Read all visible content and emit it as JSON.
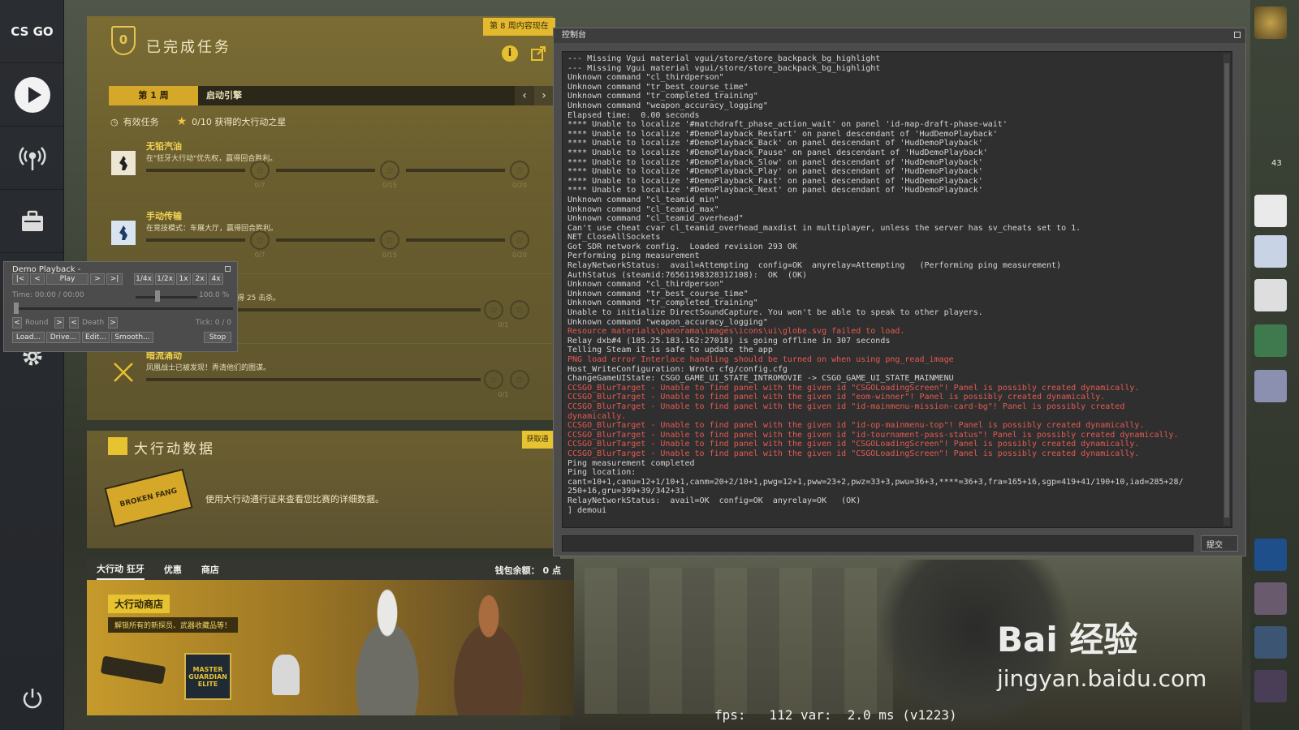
{
  "app": {
    "logo": "CS GO"
  },
  "sidebar": {
    "items": [
      {
        "icon": "play-icon"
      },
      {
        "icon": "antenna-icon"
      },
      {
        "icon": "briefcase-icon"
      },
      {
        "icon": "gear-icon"
      },
      {
        "icon": "power-icon"
      }
    ]
  },
  "missions": {
    "badge": "0",
    "title": "已完成任务",
    "week_tag": "第 8 周内容现在",
    "week_label": "第 1 周",
    "week_name": "启动引擎",
    "status_active": "有效任务",
    "status_stars": "0/10 获得的大行动之星",
    "items": [
      {
        "name": "无铅汽油",
        "desc": "在\"狂牙大行动\"优先权，赢得回合胜利。",
        "counts": [
          "0/7",
          "0/15",
          "0/20"
        ]
      },
      {
        "name": "手动传输",
        "desc": "在竞技模式：车展大厅，赢得回合胜利。",
        "counts": [
          "0/7",
          "0/15",
          "0/20"
        ]
      },
      {
        "name": "",
        "desc": "得 25 击杀。",
        "counts": [
          "",
          "0/1"
        ]
      },
      {
        "name": "暗流涌动",
        "desc": "凤凰战士已被发现！弄清他们的图谋。",
        "counts": [
          "",
          "0/1"
        ]
      }
    ]
  },
  "opdata": {
    "title": "大行动数据",
    "button": "获取通",
    "ticket": "BROKEN FANG",
    "desc": "使用大行动通行证来查看您比赛的详细数据。"
  },
  "store": {
    "tabs": [
      "大行动 狂牙",
      "优惠",
      "商店"
    ],
    "wallet": "钱包余额： 0 点",
    "banner_title": "大行动商店",
    "banner_sub": "解锁所有的新探员、武器收藏品等！",
    "patch_text": "MASTER GUARDIAN ELITE"
  },
  "console": {
    "title": "控制台",
    "submit": "提交",
    "input_value": "",
    "lines": [
      {
        "t": "--- Missing Vgui material vgui/store/store_backpack_bg_highlight",
        "e": false
      },
      {
        "t": "--- Missing Vgui material vgui/store/store_backpack_bg_highlight",
        "e": false
      },
      {
        "t": "Unknown command \"cl_thirdperson\"",
        "e": false
      },
      {
        "t": "Unknown command \"tr_best_course_time\"",
        "e": false
      },
      {
        "t": "Unknown command \"tr_completed_training\"",
        "e": false
      },
      {
        "t": "Unknown command \"weapon_accuracy_logging\"",
        "e": false
      },
      {
        "t": "Elapsed time:  0.00 seconds",
        "e": false
      },
      {
        "t": "**** Unable to localize '#matchdraft_phase_action_wait' on panel 'id-map-draft-phase-wait'",
        "e": false
      },
      {
        "t": "**** Unable to localize '#DemoPlayback_Restart' on panel descendant of 'HudDemoPlayback'",
        "e": false
      },
      {
        "t": "**** Unable to localize '#DemoPlayback_Back' on panel descendant of 'HudDemoPlayback'",
        "e": false
      },
      {
        "t": "**** Unable to localize '#DemoPlayback_Pause' on panel descendant of 'HudDemoPlayback'",
        "e": false
      },
      {
        "t": "**** Unable to localize '#DemoPlayback_Slow' on panel descendant of 'HudDemoPlayback'",
        "e": false
      },
      {
        "t": "**** Unable to localize '#DemoPlayback_Play' on panel descendant of 'HudDemoPlayback'",
        "e": false
      },
      {
        "t": "**** Unable to localize '#DemoPlayback_Fast' on panel descendant of 'HudDemoPlayback'",
        "e": false
      },
      {
        "t": "**** Unable to localize '#DemoPlayback_Next' on panel descendant of 'HudDemoPlayback'",
        "e": false
      },
      {
        "t": "Unknown command \"cl_teamid_min\"",
        "e": false
      },
      {
        "t": "Unknown command \"cl_teamid_max\"",
        "e": false
      },
      {
        "t": "Unknown command \"cl_teamid_overhead\"",
        "e": false
      },
      {
        "t": "Can't use cheat cvar cl_teamid_overhead_maxdist in multiplayer, unless the server has sv_cheats set to 1.",
        "e": false
      },
      {
        "t": "NET_CloseAllSockets",
        "e": false
      },
      {
        "t": "Got SDR network config.  Loaded revision 293 OK",
        "e": false
      },
      {
        "t": "Performing ping measurement",
        "e": false
      },
      {
        "t": "RelayNetworkStatus:  avail=Attempting  config=OK  anyrelay=Attempting   (Performing ping measurement)",
        "e": false
      },
      {
        "t": "AuthStatus (steamid:76561198328312108):  OK  (OK)",
        "e": false
      },
      {
        "t": "Unknown command \"cl_thirdperson\"",
        "e": false
      },
      {
        "t": "Unknown command \"tr_best_course_time\"",
        "e": false
      },
      {
        "t": "Unknown command \"tr_completed_training\"",
        "e": false
      },
      {
        "t": "Unable to initialize DirectSoundCapture. You won't be able to speak to other players.",
        "e": false
      },
      {
        "t": "Unknown command \"weapon_accuracy_logging\"",
        "e": false
      },
      {
        "t": "Resource materials\\panorama\\images\\icons\\ui\\globe.svg failed to load.",
        "e": true
      },
      {
        "t": "Relay dxb#4 (185.25.183.162:27018) is going offline in 307 seconds",
        "e": false
      },
      {
        "t": "Telling Steam it is safe to update the app",
        "e": false
      },
      {
        "t": "PNG load error Interlace handling should be turned on when using png_read_image",
        "e": true
      },
      {
        "t": "Host_WriteConfiguration: Wrote cfg/config.cfg",
        "e": false
      },
      {
        "t": "ChangeGameUIState: CSGO_GAME_UI_STATE_INTROMOVIE -> CSGO_GAME_UI_STATE_MAINMENU",
        "e": false
      },
      {
        "t": "CCSGO_BlurTarget - Unable to find panel with the given id \"CSGOLoadingScreen\"! Panel is possibly created dynamically.",
        "e": true
      },
      {
        "t": "CCSGO_BlurTarget - Unable to find panel with the given id \"eom-winner\"! Panel is possibly created dynamically.",
        "e": true
      },
      {
        "t": "CCSGO_BlurTarget - Unable to find panel with the given id \"id-mainmenu-mission-card-bg\"! Panel is possibly created",
        "e": true
      },
      {
        "t": "dynamically.",
        "e": true
      },
      {
        "t": "CCSGO_BlurTarget - Unable to find panel with the given id \"id-op-mainmenu-top\"! Panel is possibly created dynamically.",
        "e": true
      },
      {
        "t": "CCSGO_BlurTarget - Unable to find panel with the given id \"id-tournament-pass-status\"! Panel is possibly created dynamically.",
        "e": true
      },
      {
        "t": "CCSGO_BlurTarget - Unable to find panel with the given id \"CSGOLoadingScreen\"! Panel is possibly created dynamically.",
        "e": true
      },
      {
        "t": "CCSGO_BlurTarget - Unable to find panel with the given id \"CSGOLoadingScreen\"! Panel is possibly created dynamically.",
        "e": true
      },
      {
        "t": "Ping measurement completed",
        "e": false
      },
      {
        "t": "Ping location:",
        "e": false
      },
      {
        "t": "cant=10+1,canu=12+1/10+1,canm=20+2/10+1,pwg=12+1,pww=23+2,pwz=33+3,pwu=36+3,****=36+3,fra=165+16,sgp=419+41/190+10,iad=285+28/",
        "e": false
      },
      {
        "t": "250+16,gru=399+39/342+31",
        "e": false
      },
      {
        "t": "RelayNetworkStatus:  avail=OK  config=OK  anyrelay=OK   (OK)",
        "e": false
      },
      {
        "t": "] demoui",
        "e": false
      }
    ]
  },
  "demo": {
    "title": "Demo Playback -",
    "btn_start": "|<",
    "btn_back": "<",
    "btn_play": "Play",
    "btn_fwd": ">",
    "btn_end": ">|",
    "speeds": [
      "1/4x",
      "1/2x",
      "1x",
      "2x",
      "4x"
    ],
    "time": "Time: 00:00 / 00:00",
    "percent": "100.0 %",
    "round_label": "Round",
    "death_label": "Death",
    "tick": "Tick: 0 / 0",
    "load": "Load...",
    "drive": "Drive...",
    "edit": "Edit...",
    "smooth": "Smooth...",
    "stop": "Stop"
  },
  "hud": {
    "fps": "fps:   112 var:  2.0 ms (v1223)",
    "watermark_main": "Bai 经验",
    "watermark_sub": "jingyan.baidu.com"
  },
  "right_strip": {
    "count_text": "43"
  }
}
